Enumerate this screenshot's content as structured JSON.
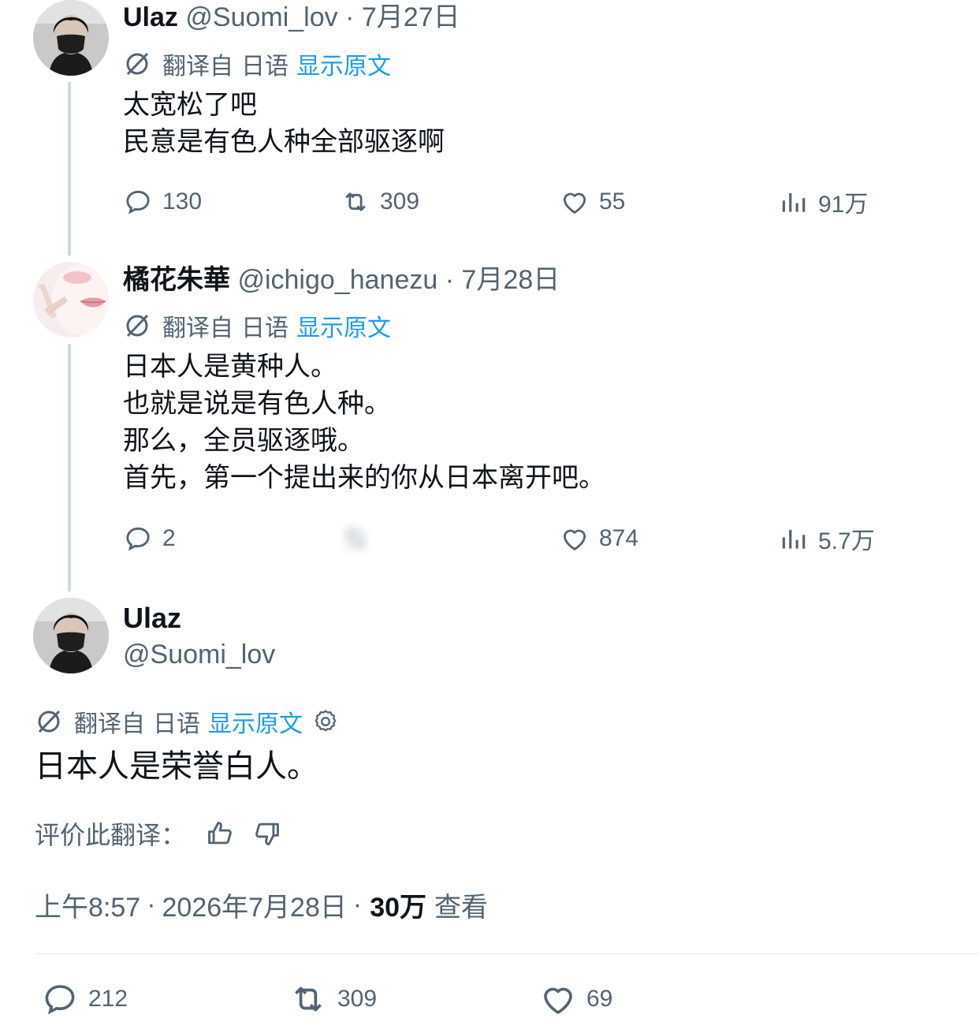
{
  "colors": {
    "text": "#0f1419",
    "secondary": "#536471",
    "link": "#1d9bf0",
    "thread": "#cfd9de"
  },
  "tweet1": {
    "name": "Ulaz",
    "handle": "@Suomi_lov",
    "sep": "·",
    "date": "7月27日",
    "translated_from": "翻译自",
    "language": "日语",
    "show_original": "显示原文",
    "lines": [
      "太宽松了吧",
      "民意是有色人种全部驱逐啊"
    ],
    "replies": "130",
    "retweets": "309",
    "likes": "55",
    "views": "91万"
  },
  "tweet2": {
    "name": "橘花朱華",
    "handle": "@ichigo_hanezu",
    "sep": "·",
    "date": "7月28日",
    "translated_from": "翻译自",
    "language": "日语",
    "show_original": "显示原文",
    "lines": [
      "日本人是黄种人。",
      "也就是说是有色人种。",
      "那么，全员驱逐哦。",
      "首先，第一个提出来的你从日本离开吧。"
    ],
    "replies": "2",
    "likes": "874",
    "views": "5.7万"
  },
  "main": {
    "name": "Ulaz",
    "handle": "@Suomi_lov",
    "translated_from": "翻译自",
    "language": "日语",
    "show_original": "显示原文",
    "text": "日本人是荣誉白人。",
    "rate_label": "评价此翻译：",
    "time": "上午8:57",
    "sep": "·",
    "date": "2026年7月28日",
    "views_count": "30万",
    "views_label": "查看",
    "replies": "212",
    "retweets": "309",
    "likes": "69"
  }
}
